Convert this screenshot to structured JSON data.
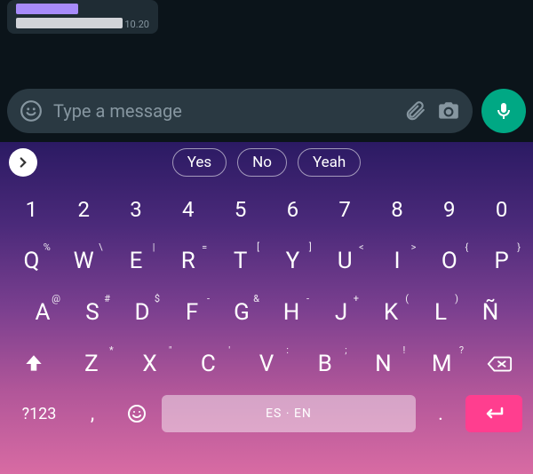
{
  "chat": {
    "time": "10.20"
  },
  "composer": {
    "placeholder": "Type a message"
  },
  "suggestions": [
    "Yes",
    "No",
    "Yeah"
  ],
  "numRow": [
    "1",
    "2",
    "3",
    "4",
    "5",
    "6",
    "7",
    "8",
    "9",
    "0"
  ],
  "row2": [
    {
      "k": "Q",
      "s": "%"
    },
    {
      "k": "W",
      "s": "\\"
    },
    {
      "k": "E",
      "s": "|"
    },
    {
      "k": "R",
      "s": "="
    },
    {
      "k": "T",
      "s": "["
    },
    {
      "k": "Y",
      "s": "]"
    },
    {
      "k": "U",
      "s": "<"
    },
    {
      "k": "I",
      "s": ">"
    },
    {
      "k": "O",
      "s": "{"
    },
    {
      "k": "P",
      "s": "}"
    }
  ],
  "row3": [
    {
      "k": "A",
      "s": "@"
    },
    {
      "k": "S",
      "s": "#"
    },
    {
      "k": "D",
      "s": "$"
    },
    {
      "k": "F",
      "s": "-"
    },
    {
      "k": "G",
      "s": "&"
    },
    {
      "k": "H",
      "s": "-"
    },
    {
      "k": "J",
      "s": "+"
    },
    {
      "k": "K",
      "s": "("
    },
    {
      "k": "L",
      "s": ")"
    },
    {
      "k": "Ñ",
      "s": ""
    }
  ],
  "row4": [
    {
      "k": "Z",
      "s": "*"
    },
    {
      "k": "X",
      "s": "\""
    },
    {
      "k": "C",
      "s": "'"
    },
    {
      "k": "V",
      "s": ":"
    },
    {
      "k": "B",
      "s": ";"
    },
    {
      "k": "N",
      "s": "!"
    },
    {
      "k": "M",
      "s": "?"
    }
  ],
  "bottom": {
    "sym": "?123",
    "comma": ",",
    "space": "ES · EN",
    "dot": "."
  }
}
